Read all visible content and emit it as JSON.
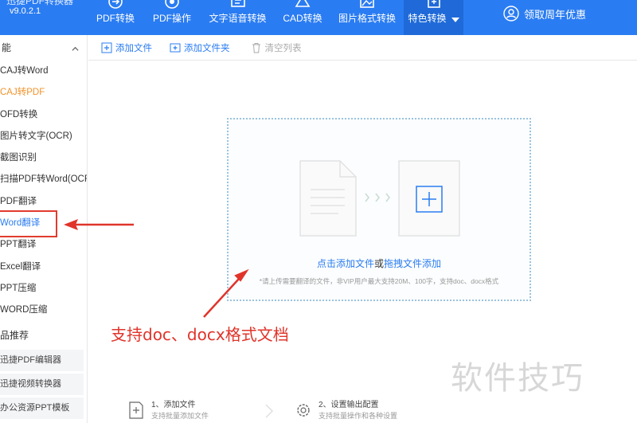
{
  "app": {
    "title": "迅捷PDF转换器",
    "version": "v9.0.2.1"
  },
  "nav": {
    "items": [
      {
        "label": "PDF转换",
        "icon": "pdf-convert-icon",
        "width": 70
      },
      {
        "label": "PDF操作",
        "icon": "pdf-operate-icon",
        "width": 72
      },
      {
        "label": "文字语音转换",
        "icon": "text-speech-icon",
        "width": 93
      },
      {
        "label": "CAD转换",
        "icon": "cad-icon",
        "width": 70
      },
      {
        "label": "图片格式转换",
        "icon": "image-format-icon",
        "width": 92
      },
      {
        "label": "特色转换",
        "icon": "special-convert-icon",
        "width": 75,
        "active": true
      }
    ],
    "promo_label": "领取周年优惠"
  },
  "sidebar": {
    "header": "能",
    "items": [
      {
        "label": "CAJ转Word"
      },
      {
        "label": "CAJ转PDF",
        "style": "orange"
      },
      {
        "label": "OFD转换"
      },
      {
        "label": "图片转文字(OCR)"
      },
      {
        "label": "截图识别"
      },
      {
        "label": "扫描PDF转Word(OCR)"
      },
      {
        "label": "PDF翻译"
      },
      {
        "label": "Word翻译",
        "style": "selected"
      },
      {
        "label": "PPT翻译"
      },
      {
        "label": "Excel翻译"
      },
      {
        "label": "PPT压缩"
      },
      {
        "label": "WORD压缩"
      }
    ],
    "recommend_header": "品推荐",
    "recommend_items": [
      {
        "label": "迅捷PDF编辑器"
      },
      {
        "label": "迅捷视频转换器"
      },
      {
        "label": "办公资源PPT模板"
      }
    ]
  },
  "toolbar": {
    "add_file": "添加文件",
    "add_folder": "添加文件夹",
    "clear_list": "清空列表"
  },
  "dropzone": {
    "link_click": "点击添加文件",
    "or": "或",
    "link_drag": "拖拽文件添加",
    "note": "*请上传需要翻译的文件，非VIP用户最大支持20M、100字，支持doc、docx格式"
  },
  "annotation": {
    "text": "支持doc、docx格式文档",
    "color": "#e0342a"
  },
  "watermark": "软件技巧",
  "steps": [
    {
      "title": "1、添加文件",
      "desc": "支持批量添加文件",
      "icon": "add-file-step-icon"
    },
    {
      "title": "2、设置输出配置",
      "desc": "支持批量操作和各种设置",
      "icon": "settings-gear-icon"
    }
  ],
  "colors": {
    "brand": "#2a7cf2",
    "nav_active": "#1f6ad8",
    "accent_orange": "#f0932b",
    "dropzone_border": "#9cc3de"
  }
}
